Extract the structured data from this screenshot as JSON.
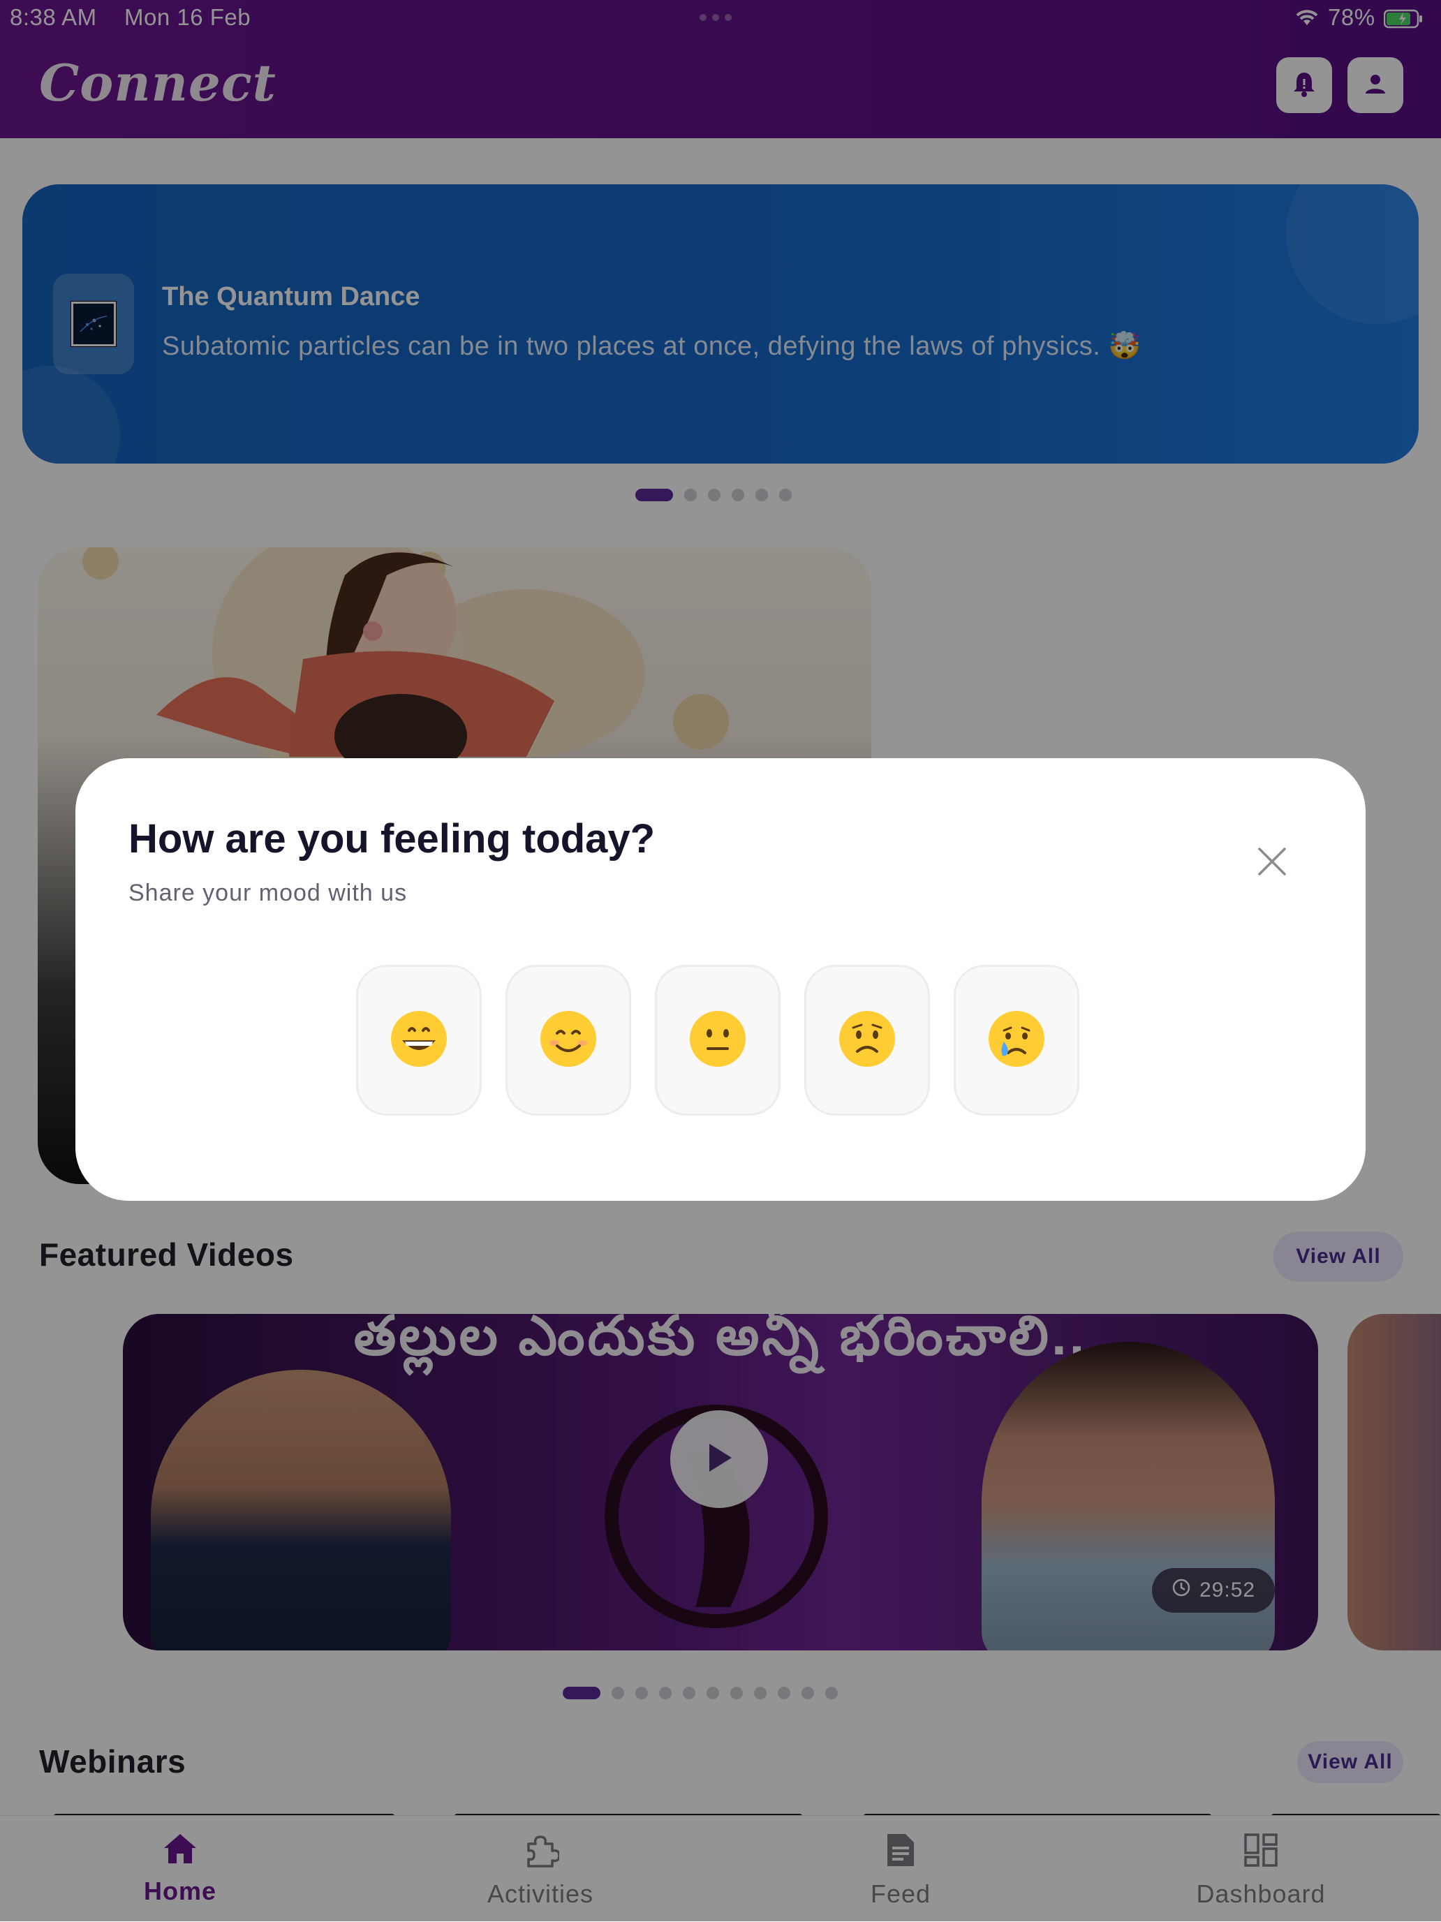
{
  "status_bar": {
    "time": "8:38 AM",
    "date": "Mon 16 Feb",
    "battery": "78%"
  },
  "header": {
    "app_title": "Connect",
    "notification_icon": "bell-icon",
    "profile_icon": "user-icon",
    "bg_color": "#5c1087"
  },
  "banner": {
    "title": "The Quantum Dance",
    "text": "Subatomic particles can be in two places at once, defying the laws of physics. 🤯",
    "carousel_count": 6,
    "active_index": 0,
    "bg_color": "#1565c0"
  },
  "featured_videos": {
    "section_title": "Featured Videos",
    "view_all": "View All",
    "video_title_text": "తల్లుల ఎందుకు అన్నీ భరించాలి..",
    "duration": "29:52",
    "carousel_count": 11,
    "active_index": 0
  },
  "webinars": {
    "section_title": "Webinars",
    "view_all": "View All"
  },
  "mood_modal": {
    "title": "How are you feeling today?",
    "subtitle": "Share your mood with us",
    "moods": [
      {
        "emoji": "😄",
        "icon": "grinning-face-icon"
      },
      {
        "emoji": "😊",
        "icon": "smiling-face-icon"
      },
      {
        "emoji": "😐",
        "icon": "neutral-face-icon"
      },
      {
        "emoji": "😟",
        "icon": "worried-face-icon"
      },
      {
        "emoji": "😢",
        "icon": "crying-face-icon"
      }
    ]
  },
  "bottom_nav": {
    "items": [
      {
        "label": "Home",
        "icon": "home-icon",
        "active": true
      },
      {
        "label": "Activities",
        "icon": "puzzle-icon",
        "active": false
      },
      {
        "label": "Feed",
        "icon": "document-icon",
        "active": false
      },
      {
        "label": "Dashboard",
        "icon": "dashboard-icon",
        "active": false
      }
    ],
    "active_color": "#6a1590"
  }
}
